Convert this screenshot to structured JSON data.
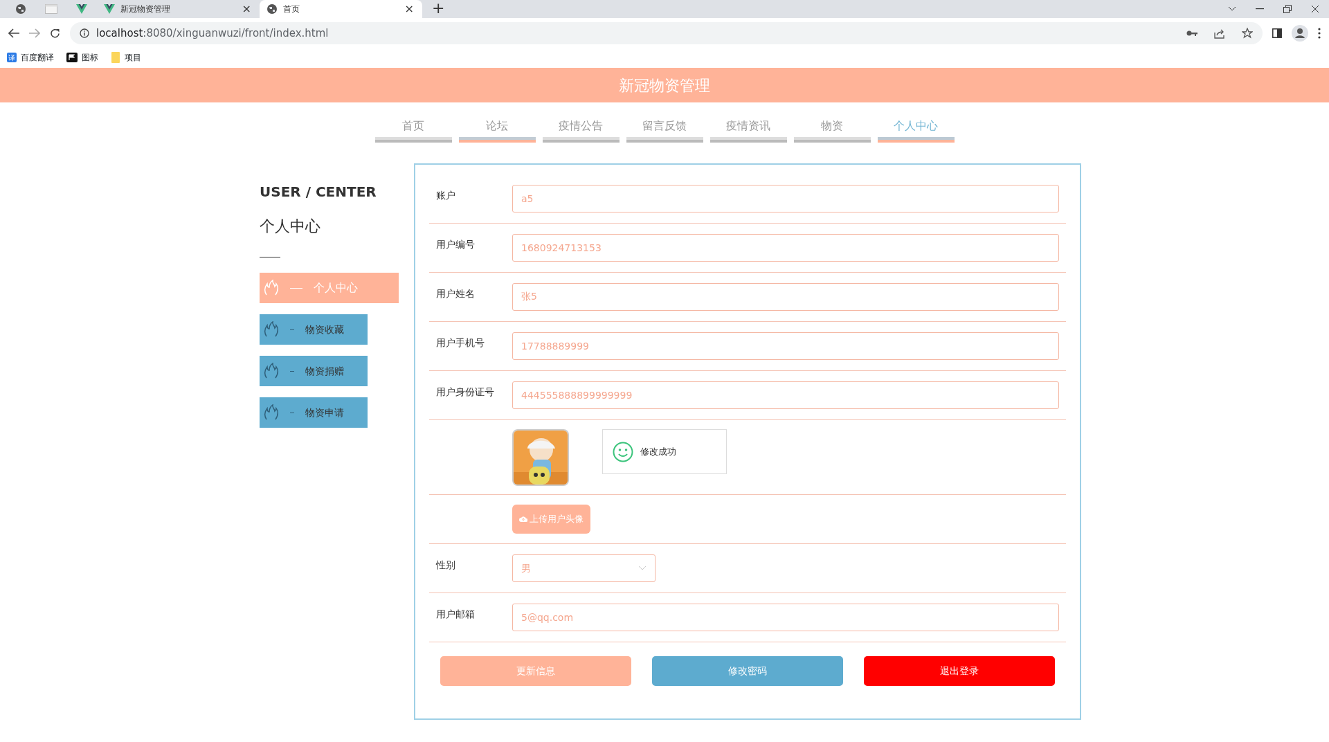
{
  "browser": {
    "tabs": [
      {
        "kind": "pinned",
        "selected": false
      },
      {
        "kind": "pinned",
        "selected": false
      },
      {
        "kind": "pinned",
        "selected": false
      },
      {
        "kind": "normal",
        "title": "新冠物资管理",
        "close": "×",
        "selected": false
      },
      {
        "kind": "normal",
        "title": "首页",
        "close": "×",
        "selected": true
      }
    ],
    "new_tab": "+",
    "url_host": "localhost",
    "url_rest": ":8080/xinguanwuzi/front/index.html",
    "bookmarks": [
      {
        "glyph": "译",
        "label": "百度翻译"
      },
      {
        "label": "图标"
      },
      {
        "label": "项目"
      }
    ]
  },
  "header": {
    "title": "新冠物资管理"
  },
  "nav": [
    {
      "label": "首页",
      "selected": false,
      "hovered": false
    },
    {
      "label": "论坛",
      "selected": false,
      "hovered": true
    },
    {
      "label": "疫情公告",
      "selected": false,
      "hovered": false
    },
    {
      "label": "留言反馈",
      "selected": false,
      "hovered": false
    },
    {
      "label": "疫情资讯",
      "selected": false,
      "hovered": false
    },
    {
      "label": "物资",
      "selected": false,
      "hovered": false
    },
    {
      "label": "个人中心",
      "selected": true,
      "hovered": false
    }
  ],
  "sidebar": {
    "title_en": "USER / CENTER",
    "title": "个人中心",
    "items": [
      {
        "label": "个人中心",
        "selected": true
      },
      {
        "label": "物资收藏",
        "selected": false
      },
      {
        "label": "物资捐赠",
        "selected": false
      },
      {
        "label": "物资申请",
        "selected": false
      }
    ]
  },
  "form": {
    "rows": [
      {
        "kind": "input",
        "label": "账户",
        "value": "a5"
      },
      {
        "kind": "input",
        "label": "用户编号",
        "value": "1680924713153"
      },
      {
        "kind": "input",
        "label": "用户姓名",
        "value": "张5"
      },
      {
        "kind": "input",
        "label": "用户手机号",
        "value": "17788889999"
      },
      {
        "kind": "input",
        "label": "用户身份证号",
        "value": "444555888899999999"
      },
      {
        "kind": "avatar"
      },
      {
        "kind": "upload",
        "button": "上传用户头像"
      },
      {
        "kind": "select",
        "label": "性别",
        "value": "男"
      },
      {
        "kind": "input",
        "label": "用户邮箱",
        "value": "5@qq.com"
      }
    ],
    "buttons": [
      {
        "kind": "update",
        "label": "更新信息"
      },
      {
        "kind": "password",
        "label": "修改密码"
      },
      {
        "kind": "logout",
        "label": "退出登录"
      }
    ]
  },
  "toast": {
    "message": "修改成功"
  }
}
